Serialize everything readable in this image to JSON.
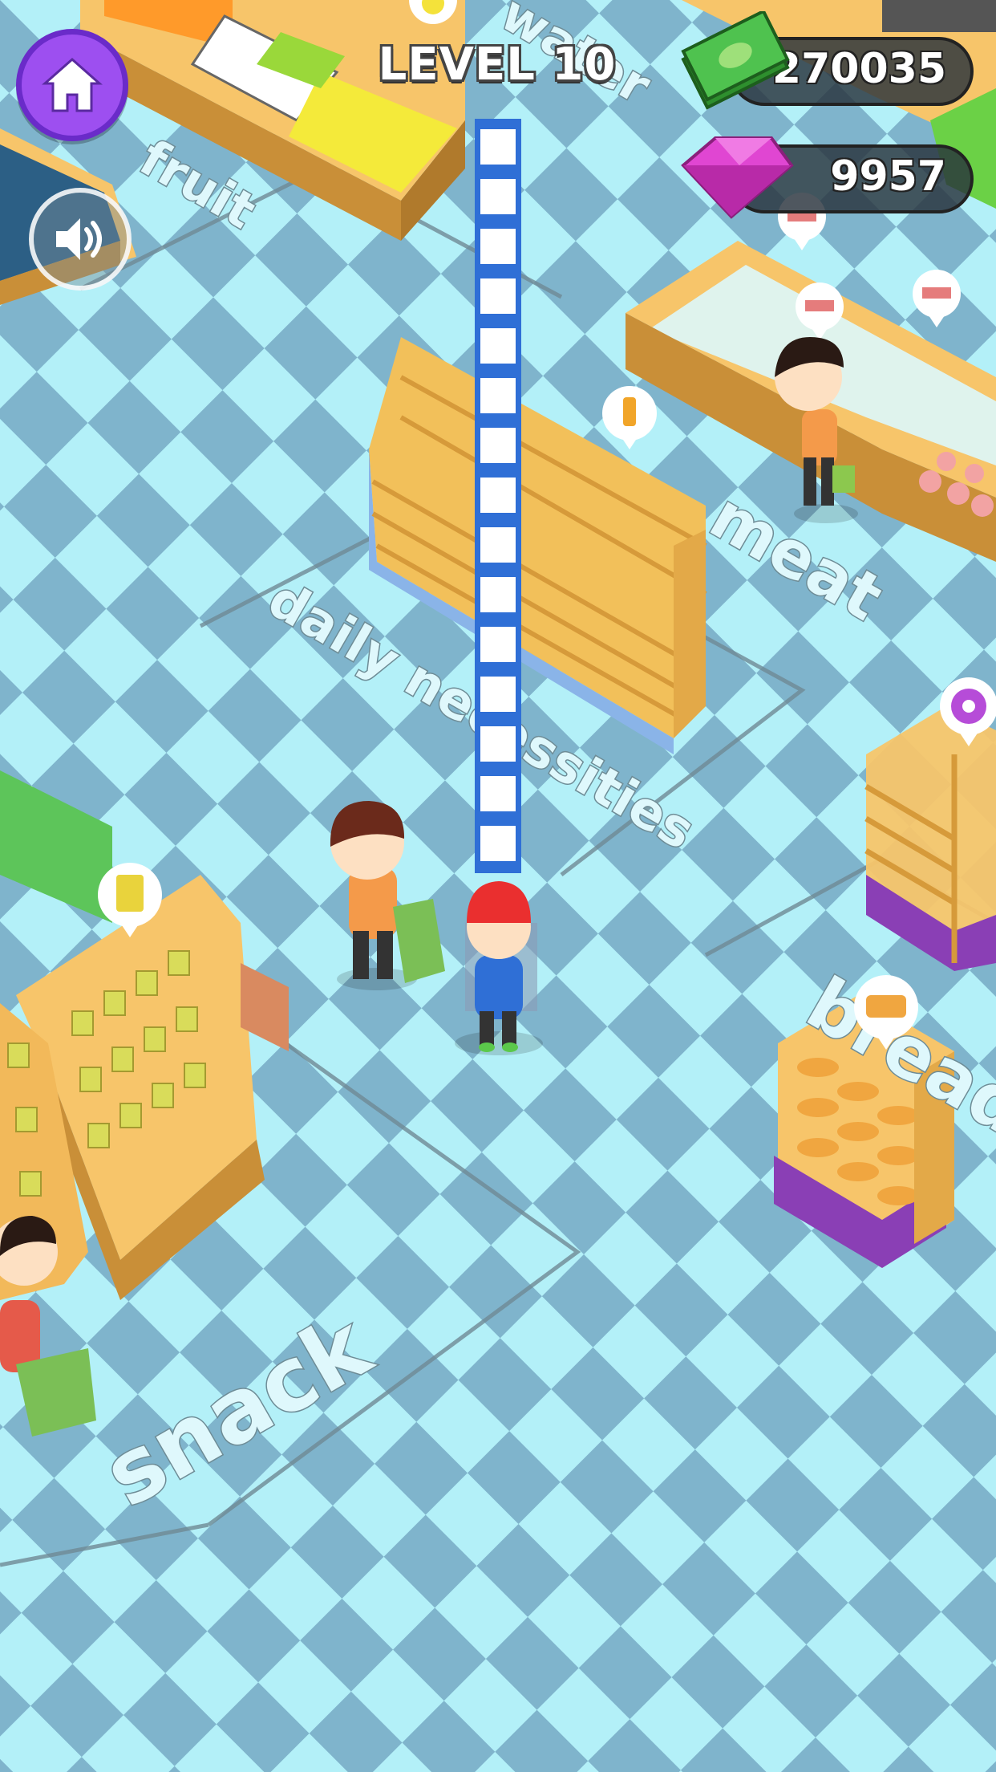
{
  "hud": {
    "level_label": "LEVEL 10",
    "cash_value": "270035",
    "gem_value": "9957",
    "home_icon": "home-icon",
    "sound_icon": "speaker-icon",
    "cash_icon": "cash-stack-icon",
    "gem_icon": "pink-gem-icon"
  },
  "zones": {
    "fruit": "fruit",
    "water": "water",
    "meat": "meat",
    "daily": "daily necessities",
    "bread": "bread",
    "snack": "snack"
  },
  "colors": {
    "floor_light": "#b3f0f8",
    "floor_dark": "#7fb4cc",
    "shelf": "#f7c56a",
    "home_button": "#9d4ff0",
    "cash": "#3cb83c",
    "gem": "#e046d2"
  }
}
